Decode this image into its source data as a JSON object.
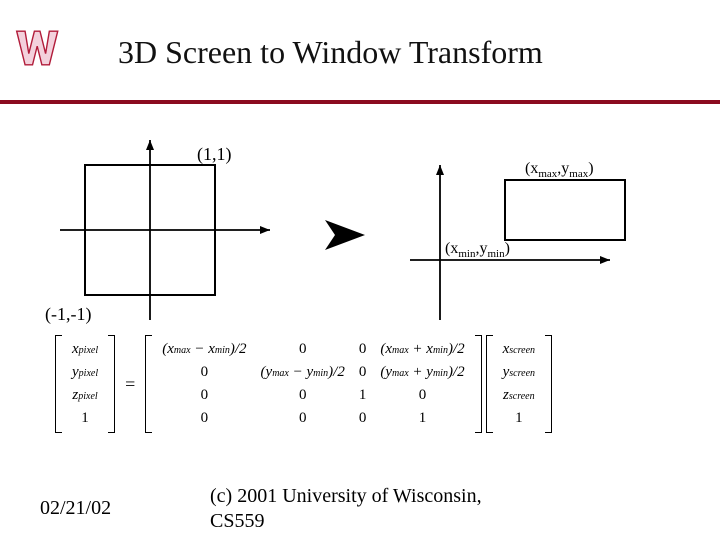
{
  "title": "3D Screen to Window Transform",
  "footer": {
    "date": "02/21/02",
    "copyright": "(c) 2001 University of Wisconsin, CS559"
  },
  "diagram_left": {
    "tl_x": "(1",
    "tl_y": "1)",
    "bl_x": "(-1",
    "bl_y": "-1)"
  },
  "diagram_right": {
    "tr_xa": "(x",
    "tr_xs": "max",
    "tr_ya": ",y",
    "tr_ys": "max",
    "tr_end": ")",
    "bl_xa": "(x",
    "bl_xs": "min",
    "bl_ya": ",y",
    "bl_ys": "min",
    "bl_end": ")"
  },
  "eq": "=",
  "vec_pixel": {
    "r0": "x",
    "r0s": "pixel",
    "r1": "y",
    "r1s": "pixel",
    "r2": "z",
    "r2s": "pixel",
    "r3": "1"
  },
  "vec_screen": {
    "r0": "x",
    "r0s": "screen",
    "r1": "y",
    "r1s": "screen",
    "r2": "z",
    "r2s": "screen",
    "r3": "1"
  },
  "matrix4": {
    "r0c0a": "(x",
    "r0c0s1": "max",
    "r0c0b": " − x",
    "r0c0s2": "min",
    "r0c0c": ")/2",
    "r0c1": "0",
    "r0c2": "0",
    "r0c3a": "(x",
    "r0c3s1": "max",
    "r0c3b": " + x",
    "r0c3s2": "min",
    "r0c3c": ")/2",
    "r1c0": "0",
    "r1c1a": "(y",
    "r1c1s1": "max",
    "r1c1b": " − y",
    "r1c1s2": "min",
    "r1c1c": ")/2",
    "r1c2": "0",
    "r1c3a": "(y",
    "r1c3s1": "max",
    "r1c3b": " + y",
    "r1c3s2": "min",
    "r1c3c": ")/2",
    "r2c0": "0",
    "r2c1": "0",
    "r2c2": "1",
    "r2c3": "0",
    "r3c0": "0",
    "r3c1": "0",
    "r3c2": "0",
    "r3c3": "1"
  }
}
